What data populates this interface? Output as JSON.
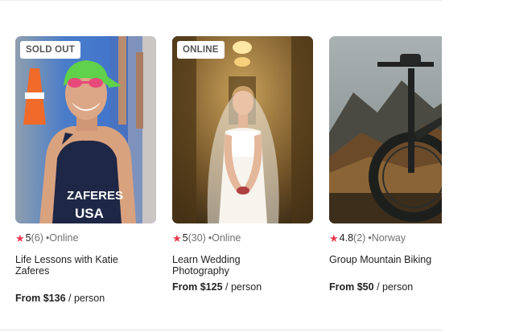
{
  "cards": [
    {
      "badge": "SOLD OUT",
      "rating": "5",
      "reviews": "(6)",
      "location": "•Online",
      "title": "Life Lessons with Katie Zaferes",
      "price": "From $136",
      "per": "/ person",
      "image_icon": "athlete-photo"
    },
    {
      "badge": "ONLINE",
      "rating": "5",
      "reviews": "(30)",
      "location": "•Online",
      "title": "Learn Wedding Photography",
      "price": "From $125",
      "per": "/ person",
      "image_icon": "bride-photo"
    },
    {
      "badge": "",
      "rating": "4.8",
      "reviews": "(2)",
      "location": "•Norway",
      "title": "Group Mountain Biking",
      "price": "From $50",
      "per": "/ person",
      "image_icon": "mountain-bike-photo"
    }
  ],
  "colors": {
    "star": "#e8384f",
    "text": "#222222",
    "muted": "#717171"
  }
}
